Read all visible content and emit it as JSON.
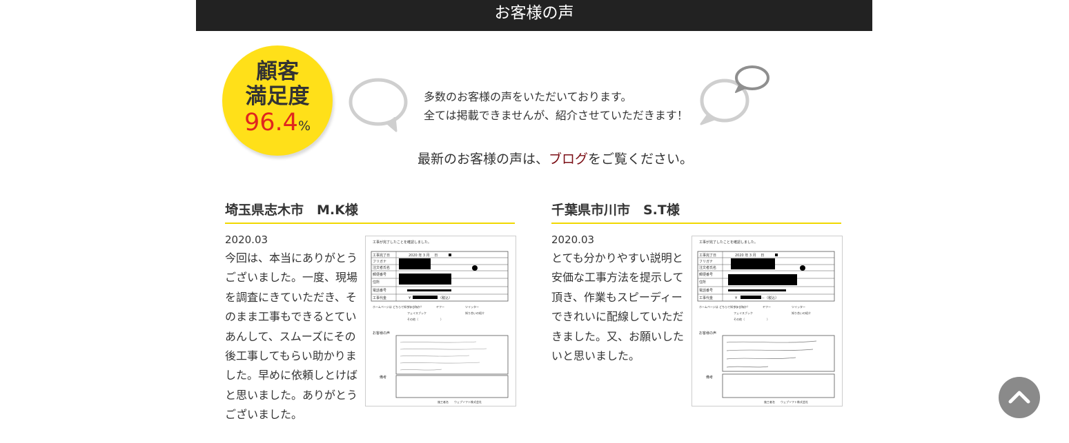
{
  "header": {
    "title": "お客様の声"
  },
  "badge": {
    "line1": "顧客",
    "line2": "満足度",
    "percent": "96.4",
    "unit": "%"
  },
  "intro": {
    "line1": "多数のお客様の声をいただいております。",
    "line2": "全ては掲載できませんが、紹介させていただきます！"
  },
  "latest": {
    "prefix": "最新のお客様の声は、",
    "link": "ブログ",
    "suffix": "をご覧ください。"
  },
  "reviews": [
    {
      "title": "埼玉県志木市　M.K様",
      "date": "2020.03",
      "body": "今回は、本当にありがとうございました。一度、現場を調査にきていただき、そのまま工事もできるとていあんして、スムーズにその後工事してもらい助かりました。早めに依頼しとけばと思いました。ありがとうございました。"
    },
    {
      "title": "千葉県市川市　S.T様",
      "date": "2020.03",
      "body": "とても分かりやすい説明と安価な工事方法を提示して頂き、作業もスピーディーできれいに配線していただきました。又、お願いしたいと思いました。"
    }
  ],
  "form": {
    "heading": "工事が完了したことを確認しました。",
    "row_labels": [
      "工事完了日",
      "フリガナ",
      "注文者氏名",
      "郵便番号",
      "住所",
      "電話番号",
      "工事代金"
    ],
    "date_value": "2020 年 3 月 　日",
    "price_value": "¥　　　　　　　－（税込）",
    "source_label": "ホームページは どちらで知りましたか？",
    "source_options": [
      "グーグル",
      "ヤフー",
      "ツイッター",
      "フェイスブック",
      "知り合いの紹介",
      "その他（　　　　　　　　）"
    ],
    "voice_label": "お客様の声",
    "note_label": "備考",
    "footer": "施工者名　　ウェブソフト株式会社"
  },
  "colors": {
    "header_bg": "#222222",
    "badge_bg": "#ffe019",
    "badge_percent": "#e0261e",
    "underline": "#f0d800",
    "link": "#7a0d14",
    "scroll_button": "#8a8a8a"
  },
  "icons": {
    "speech_left": "speech-bubble-icon",
    "speech_right": "double-speech-bubble-icon",
    "scroll_top": "chevron-up-icon"
  }
}
